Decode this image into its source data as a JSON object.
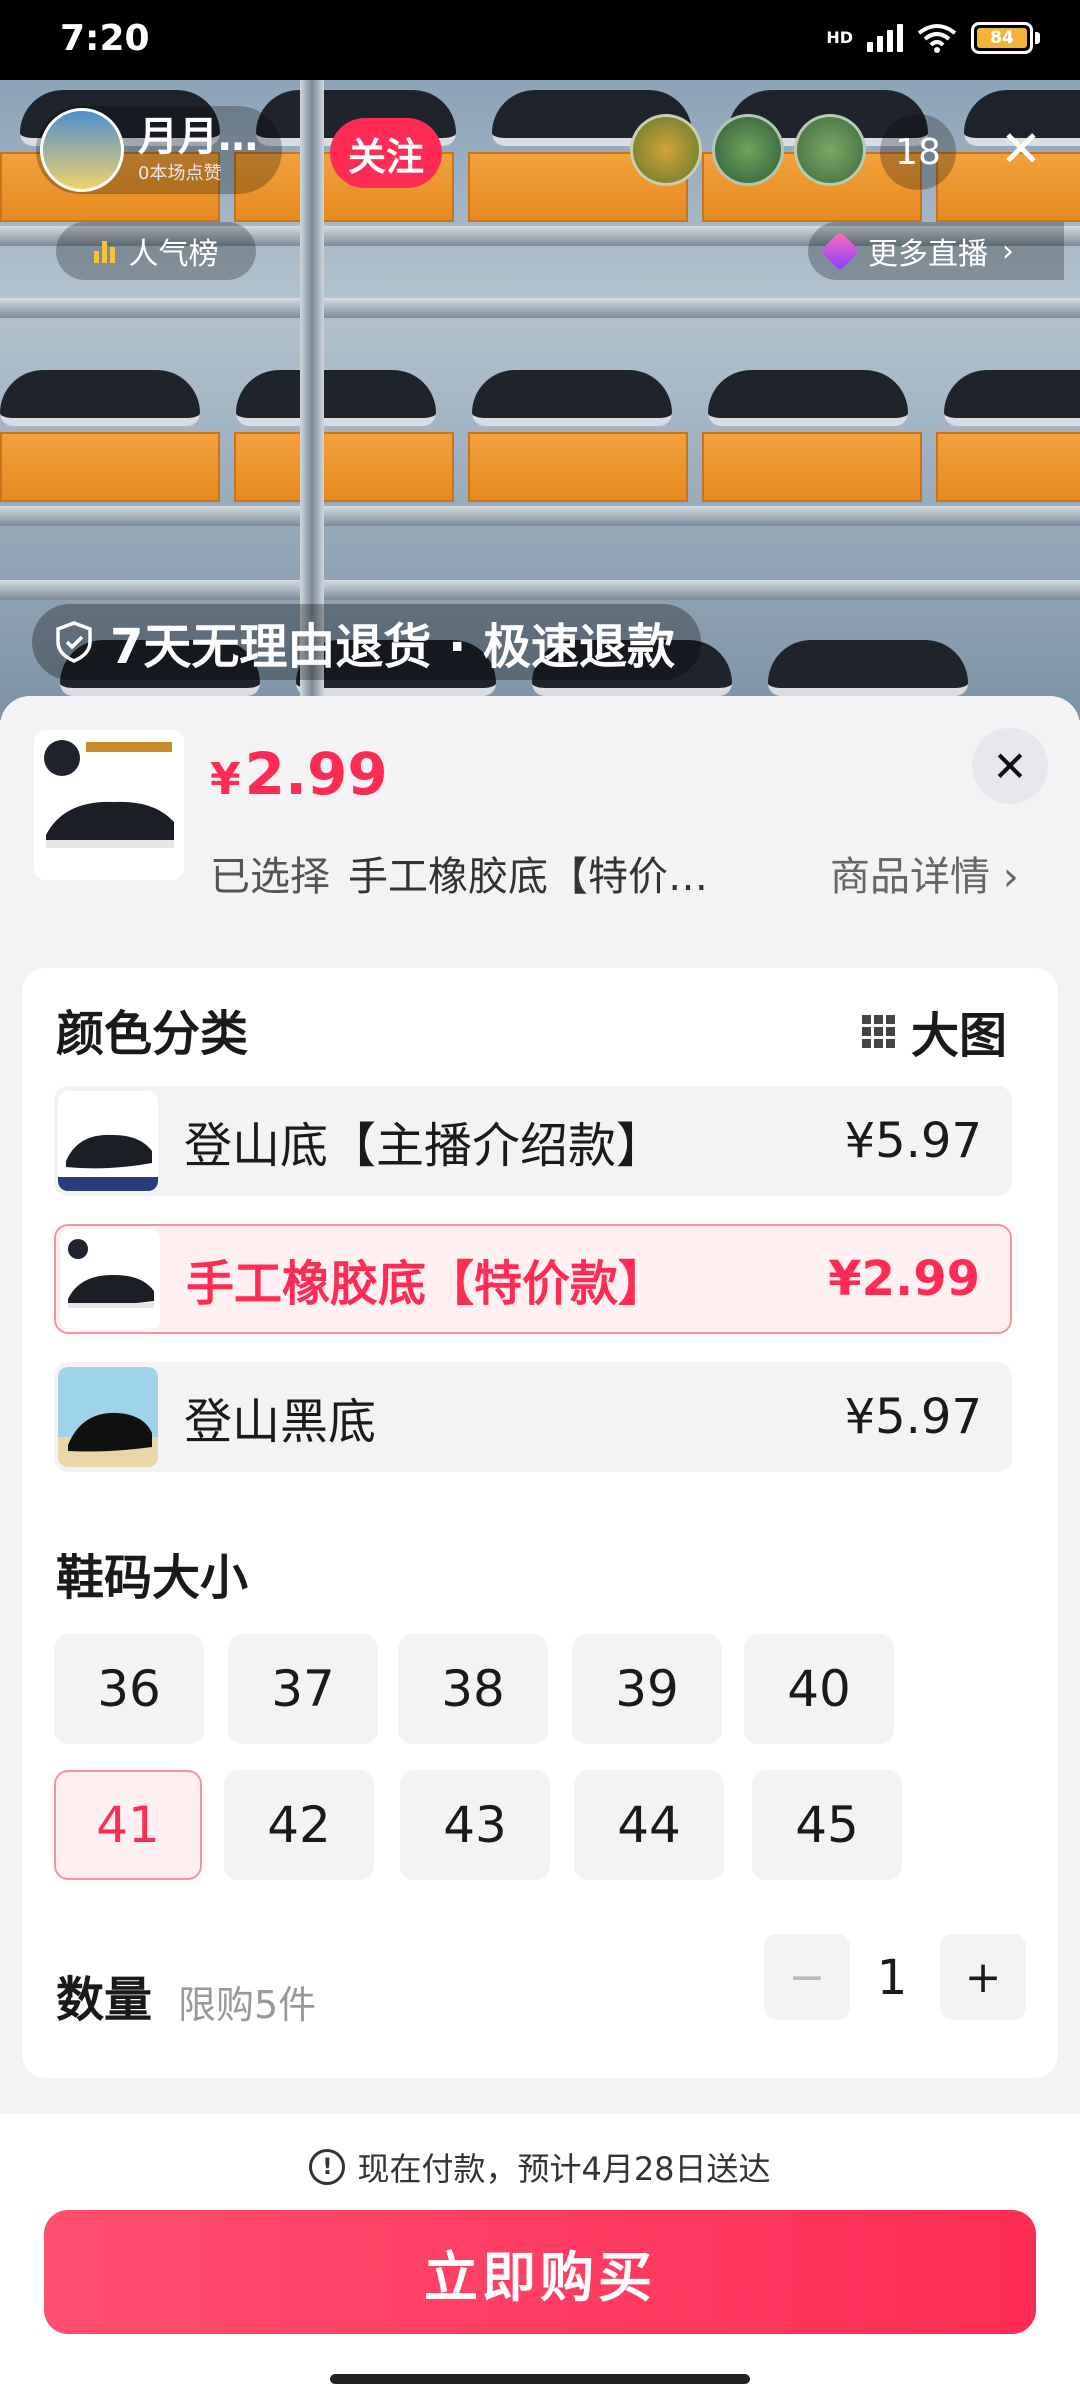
{
  "status_bar": {
    "time": "7:20",
    "hd": "HD",
    "battery": "84"
  },
  "live": {
    "host_name": "月月…",
    "host_likes": "0本场点赞",
    "follow_label": "关注",
    "viewer_count": "18",
    "rank_label": "人气榜",
    "more_live_label": "更多直播",
    "returns_banner": "7天无理由退货 · 极速退款"
  },
  "product": {
    "price_symbol": "¥",
    "price": "2.99",
    "selected_label": "已选择",
    "selected_value": "手工橡胶底【特价…",
    "detail_label": "商品详情"
  },
  "color_section": {
    "title": "颜色分类",
    "big_pic_label": "大图",
    "options": [
      {
        "name": "登山底【主播介绍款】",
        "price": "¥5.97",
        "selected": false
      },
      {
        "name": "手工橡胶底【特价款】",
        "price": "¥2.99",
        "selected": true
      },
      {
        "name": "登山黑底",
        "price": "¥5.97",
        "selected": false
      }
    ]
  },
  "size_section": {
    "title": "鞋码大小",
    "sizes": [
      "36",
      "37",
      "38",
      "39",
      "40",
      "41",
      "42",
      "43",
      "44",
      "45"
    ],
    "selected": "41"
  },
  "quantity": {
    "label": "数量",
    "limit": "限购5件",
    "value": "1",
    "minus": "−",
    "plus": "+"
  },
  "footer": {
    "notice": "现在付款，预计4月28日送达",
    "buy_label": "立即购买"
  },
  "colors": {
    "accent": "#fe2c55",
    "selected_bg": "#fff0f2",
    "follow": "#fe2c55"
  }
}
